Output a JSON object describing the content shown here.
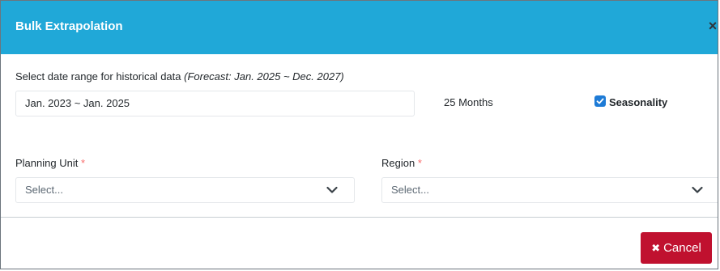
{
  "dialog": {
    "title": "Bulk Extrapolation",
    "close_glyph": "×"
  },
  "date_range": {
    "label": "Select date range for historical data ",
    "hint": "(Forecast: Jan. 2025 ~ Dec. 2027)",
    "value": "Jan. 2023 ~ Jan. 2025",
    "months_text": "25 Months"
  },
  "seasonality": {
    "label": "Seasonality",
    "checked": true
  },
  "planning_unit": {
    "label": "Planning Unit",
    "required_mark": "*",
    "placeholder": "Select..."
  },
  "region": {
    "label": "Region",
    "required_mark": "*",
    "placeholder": "Select..."
  },
  "footer": {
    "cancel_label": "Cancel",
    "cancel_icon": "✖"
  },
  "colors": {
    "header": "#20a8d8",
    "cancel": "#c0112f",
    "checkbox": "#1e7bd6",
    "required": "#f86c6b"
  }
}
